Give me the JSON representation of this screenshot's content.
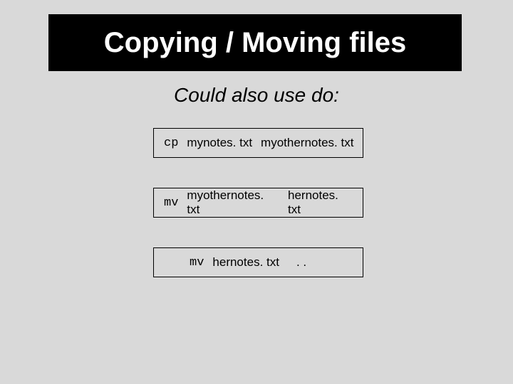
{
  "title": "Copying / Moving files",
  "subtitle": "Could also use do:",
  "commands": [
    {
      "cmd": "cp",
      "arg1": "mynotes. txt",
      "arg2": "myothernotes. txt"
    },
    {
      "cmd": "mv",
      "arg1": "myothernotes. txt",
      "arg2": "hernotes. txt"
    },
    {
      "cmd": "mv",
      "arg1": "hernotes. txt",
      "arg2": ". ."
    }
  ]
}
